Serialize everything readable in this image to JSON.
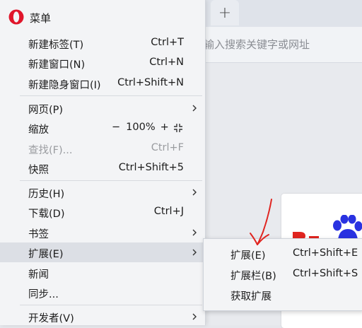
{
  "browser": {
    "new_tab_symbol": "+",
    "address_placeholder": "输入搜索关键字或网址"
  },
  "menu": {
    "title": "菜单",
    "logo_icon": "opera-logo-icon",
    "items": [
      {
        "label": "新建标签(T)",
        "shortcut": "Ctrl+T"
      },
      {
        "label": "新建窗口(N)",
        "shortcut": "Ctrl+N"
      },
      {
        "label": "新建隐身窗口(I)",
        "shortcut": "Ctrl+Shift+N"
      },
      {
        "label": "网页(P)",
        "shortcut": ""
      },
      {
        "label": "缩放",
        "shortcut": ""
      },
      {
        "label": "查找(F)...",
        "shortcut": "Ctrl+F"
      },
      {
        "label": "快照",
        "shortcut": "Ctrl+Shift+5"
      },
      {
        "label": "历史(H)",
        "shortcut": ""
      },
      {
        "label": "下载(D)",
        "shortcut": "Ctrl+J"
      },
      {
        "label": "书签",
        "shortcut": ""
      },
      {
        "label": "扩展(E)",
        "shortcut": ""
      },
      {
        "label": "新闻",
        "shortcut": ""
      },
      {
        "label": "同步...",
        "shortcut": ""
      },
      {
        "label": "开发者(V)",
        "shortcut": ""
      }
    ],
    "zoom": {
      "minus": "−",
      "value": "100%",
      "plus": "+"
    }
  },
  "submenu": {
    "items": [
      {
        "label": "扩展(E)",
        "shortcut": "Ctrl+Shift+E"
      },
      {
        "label": "扩展栏(B)",
        "shortcut": "Ctrl+Shift+S"
      },
      {
        "label": "获取扩展",
        "shortcut": ""
      }
    ]
  },
  "colors": {
    "opera_red": "#e0162b",
    "annotation_red": "#e0241f",
    "menu_bg": "#f3f4f6",
    "highlight_bg": "#dcdfe5",
    "disabled_text": "#9a9ca0",
    "baidu_blue": "#2932e1"
  }
}
